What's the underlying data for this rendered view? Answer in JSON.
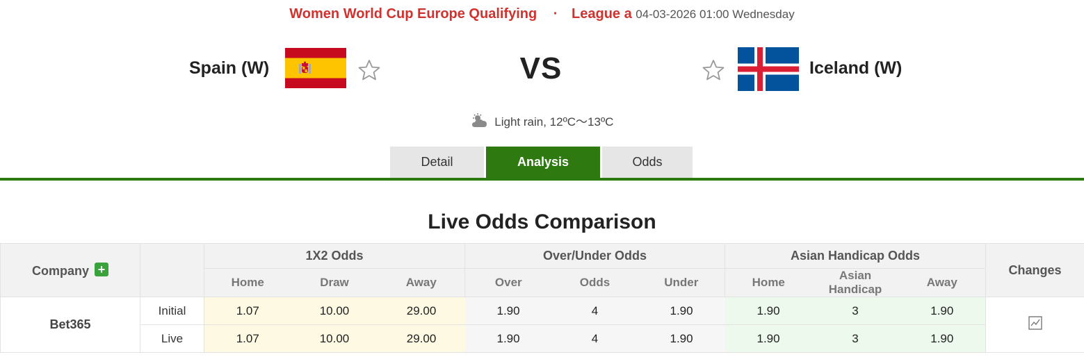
{
  "match": {
    "league": "Women World Cup Europe Qualifying",
    "separator": "·",
    "group": "League a",
    "datetime": "04-03-2026 01:00 Wednesday",
    "vs": "VS",
    "home": {
      "name": "Spain (W)",
      "flag": "spain-flag"
    },
    "away": {
      "name": "Iceland (W)",
      "flag": "iceland-flag"
    },
    "weather": "Light rain, 12ºC～13ºC"
  },
  "tabs": [
    {
      "label": "Detail",
      "active": false
    },
    {
      "label": "Analysis",
      "active": true
    },
    {
      "label": "Odds",
      "active": false
    }
  ],
  "odds": {
    "title": "Live Odds Comparison",
    "company_header": "Company",
    "changes_header": "Changes",
    "groups": [
      "1X2 Odds",
      "Over/Under Odds",
      "Asian Handicap Odds"
    ],
    "subheaders": [
      "Home",
      "Draw",
      "Away",
      "Over",
      "Odds",
      "Under",
      "Home",
      "Asian Handicap",
      "Away"
    ],
    "company": "Bet365",
    "rows": [
      {
        "type": "Initial",
        "values": [
          "1.07",
          "10.00",
          "29.00",
          "1.90",
          "4",
          "1.90",
          "1.90",
          "3",
          "1.90"
        ]
      },
      {
        "type": "Live",
        "values": [
          "1.07",
          "10.00",
          "29.00",
          "1.90",
          "4",
          "1.90",
          "1.90",
          "3",
          "1.90"
        ]
      }
    ]
  },
  "colors": {
    "league": "#d0322f",
    "tab_active": "#2f7a10",
    "odds_1x2_bg": "#fdf9e3",
    "odds_ah_bg": "#eef9ee",
    "plus_button": "#3aa23a"
  }
}
